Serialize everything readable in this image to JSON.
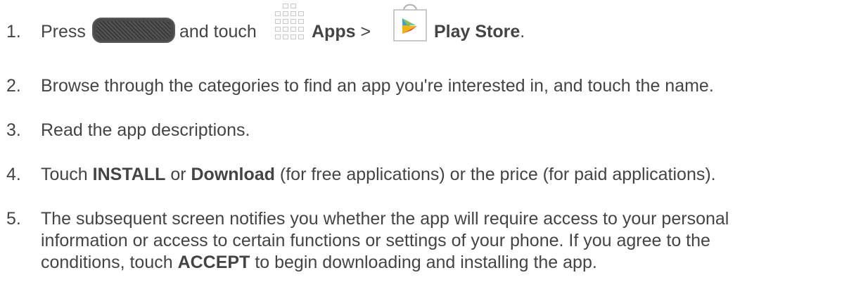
{
  "steps": [
    {
      "number": "1.",
      "press": "Press",
      "and_touch": "and touch",
      "apps": "Apps",
      "sep": ">",
      "play_store": "Play Store",
      "period": "."
    },
    {
      "number": "2.",
      "text": "Browse through the categories to find an app you're interested in, and touch the name."
    },
    {
      "number": "3.",
      "text": "Read the app descriptions."
    },
    {
      "number": "4.",
      "touch": "Touch",
      "install": "INSTALL",
      "or": "or",
      "download": "Download",
      "rest": "(for free applications) or the price (for paid applications)."
    },
    {
      "number": "5.",
      "line1": "The subsequent screen notifies you whether the app will require access to your personal",
      "line2": "information or access to certain functions or settings of your phone. If you agree to the",
      "line3_pre": "conditions, touch",
      "accept": "ACCEPT",
      "line3_post": "to begin downloading and installing the app."
    }
  ],
  "icons": {
    "home_key": "home-key-icon",
    "apps": "apps-grid-icon",
    "play_store": "play-store-bag-icon",
    "play_colors": [
      "#4ec4e8",
      "#3c9fe0",
      "#8bc34a",
      "#f4b400",
      "#e53935"
    ]
  }
}
